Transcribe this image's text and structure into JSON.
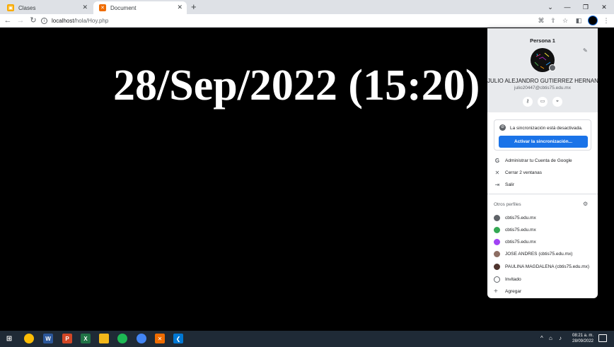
{
  "browser": {
    "tabs": [
      {
        "title": "Clases",
        "active": false,
        "favicon_color": "#f9ab00"
      },
      {
        "title": "Document",
        "active": true,
        "favicon_color": "#ef6c00"
      }
    ],
    "url_host": "localhost",
    "url_path": "/hola/Hoy.php"
  },
  "page": {
    "heading": "28/Sep/2022 (15:20)"
  },
  "profile_menu": {
    "title": "Persona 1",
    "name": "JULIO ALEJANDRO GUTIERREZ HERNAND...",
    "email": "julio20447@cbtis75.edu.mx",
    "sync_status": "La sincronización está desactivada.",
    "sync_button": "Activar la sincronización...",
    "actions": [
      {
        "icon": "google-icon",
        "label": "Administrar tu Cuenta de Google"
      },
      {
        "icon": "close-icon",
        "label": "Cerrar 2 ventanas"
      },
      {
        "icon": "exit-icon",
        "label": "Salir"
      }
    ],
    "other_profiles_label": "Otros perfiles",
    "profiles": [
      {
        "label": "cbtis75.edu.mx",
        "color": "#5f6368"
      },
      {
        "label": "cbtis75.edu.mx",
        "color": "#34a853"
      },
      {
        "label": "cbtis75.edu.mx",
        "color": "#a142f4"
      },
      {
        "label": "JOSE ANDRES (cbtis75.edu.mx)",
        "color": "#8d6e63"
      },
      {
        "label": "PAULINA MAGDALENA (cbtis75.edu.mx)",
        "color": "#4e342e"
      },
      {
        "label": "Invitado",
        "color": "#5f6368"
      },
      {
        "label": "Agregar",
        "color": "#5f6368"
      }
    ]
  },
  "taskbar": {
    "time": "08:21 a. m.",
    "date": "28/09/2022"
  }
}
